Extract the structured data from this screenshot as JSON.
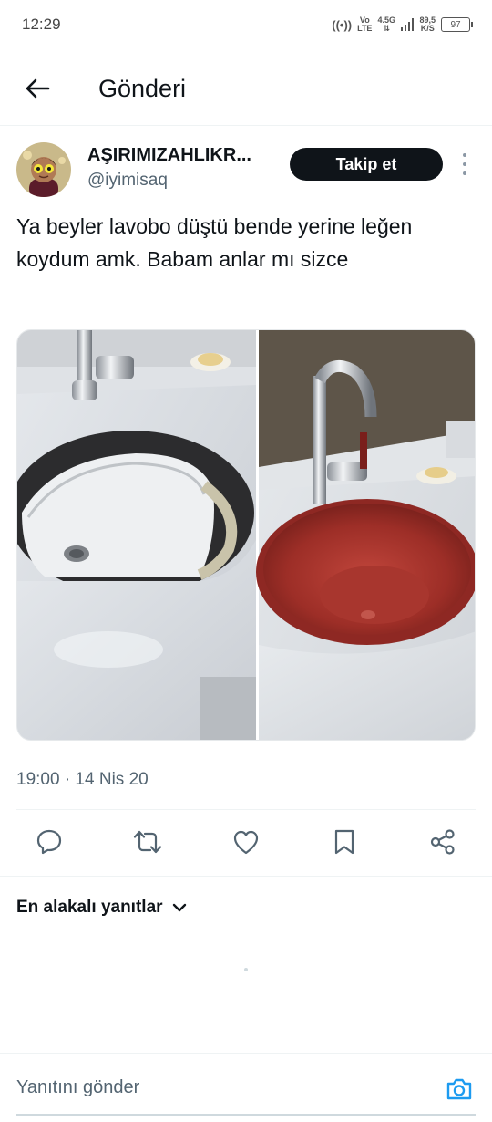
{
  "status_bar": {
    "time": "12:29",
    "volte_top": "Vo",
    "volte_bottom": "LTE",
    "network": "4.5G",
    "speed_value": "89,5",
    "speed_unit": "K/S",
    "battery": "97",
    "hotspot_icon": "hotspot-icon"
  },
  "header": {
    "back_icon": "arrow-left-icon",
    "title": "Gönderi"
  },
  "author": {
    "name": "AŞIRIMIZAHLIKR...",
    "handle": "@iyimisaq",
    "follow_label": "Takip et",
    "more_icon": "more-vertical-icon"
  },
  "tweet": {
    "text": "Ya beyler lavobo düştü bende yerine leğen koydum amk. Babam anlar mı sizce",
    "timestamp": "19:00 · 14 Nis 20"
  },
  "actions": [
    {
      "name": "reply",
      "icon": "reply-icon"
    },
    {
      "name": "retweet",
      "icon": "retweet-icon"
    },
    {
      "name": "like",
      "icon": "heart-icon"
    },
    {
      "name": "bookmark",
      "icon": "bookmark-icon"
    },
    {
      "name": "share",
      "icon": "share-icon"
    }
  ],
  "replies": {
    "sort_label": "En alakalı yanıtlar"
  },
  "reply_bar": {
    "placeholder": "Yanıtını gönder",
    "camera_icon": "camera-icon"
  },
  "colors": {
    "follow_bg": "#0f1419",
    "accent": "#1d9bf0",
    "secondary_text": "#536471",
    "basin_red": "#a4302a"
  }
}
